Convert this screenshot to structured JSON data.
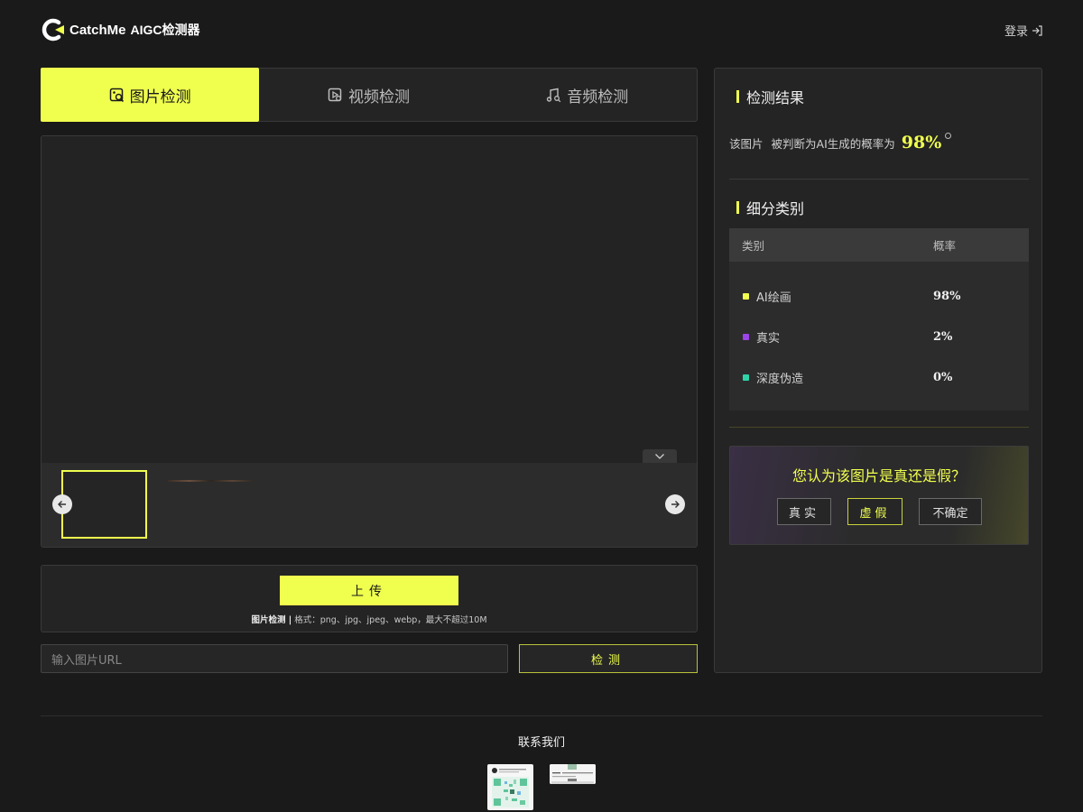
{
  "header": {
    "brand": "CatchMe",
    "brand_sub": "AIGC检测器",
    "login_label": "登录"
  },
  "tabs": [
    {
      "label": "图片检测",
      "icon": "image-search-icon",
      "active": true
    },
    {
      "label": "视频检测",
      "icon": "video-play-icon",
      "active": false
    },
    {
      "label": "音频检测",
      "icon": "music-search-icon",
      "active": false
    }
  ],
  "upload": {
    "button_label": "上传",
    "hint_bold": "图片检测 |",
    "hint_rest": " 格式：png、jpg、jpeg、webp，最大不超过10M"
  },
  "url": {
    "placeholder": "输入图片URL",
    "detect_label": "检测"
  },
  "results": {
    "title": "检测结果",
    "line_prefix": "该图片",
    "line_mid": "被判断为AI生成的概率为",
    "probability": "98%",
    "breakdown_title": "细分类别",
    "table_headers": [
      "类别",
      "概率"
    ],
    "rows": [
      {
        "label": "AI绘画",
        "value": "98%",
        "color": "#f0ff4e"
      },
      {
        "label": "真实",
        "value": "2%",
        "color": "#9b45e8"
      },
      {
        "label": "深度伪造",
        "value": "0%",
        "color": "#2ed3a8"
      }
    ]
  },
  "vote": {
    "question": "您认为该图片是真还是假？",
    "options": [
      "真实",
      "虚假",
      "不确定"
    ],
    "selected": "虚假"
  },
  "footer": {
    "contact_label": "联系我们"
  },
  "colors": {
    "accent": "#f0ff4e",
    "background": "#1a1a1a",
    "panel": "#242424"
  }
}
